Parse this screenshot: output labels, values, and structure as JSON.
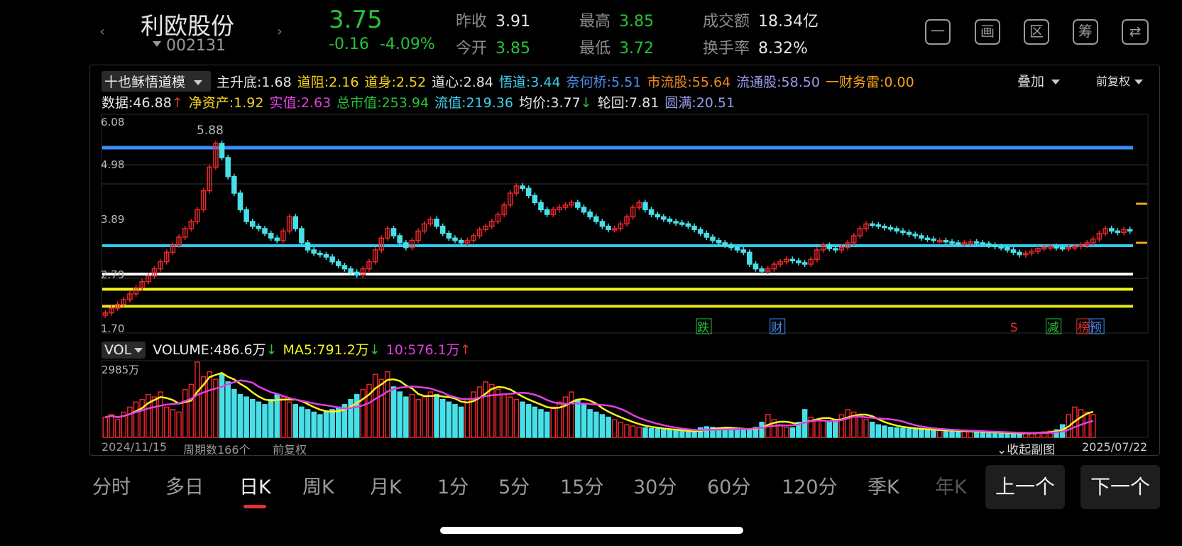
{
  "header": {
    "stock_name": "利欧股份",
    "stock_code": "002131",
    "price": "3.75",
    "change": "-0.16",
    "change_pct": "-4.09%",
    "prev_close_label": "昨收",
    "prev_close": "3.91",
    "open_label": "今开",
    "open": "3.85",
    "high_label": "最高",
    "high": "3.85",
    "low_label": "最低",
    "low": "3.72",
    "turnover_label": "成交额",
    "turnover": "18.34亿",
    "turnover_rate_label": "换手率",
    "turnover_rate": "8.32%",
    "tools": [
      "一",
      "画",
      "区",
      "筹",
      ""
    ]
  },
  "indicator": {
    "name": "十也稣悟道模",
    "items": [
      {
        "label": "主升底",
        "value": "1.68",
        "color": "#e6e6e6"
      },
      {
        "label": "道阻",
        "value": "2.16",
        "color": "#f5d31b"
      },
      {
        "label": "道身",
        "value": "2.52",
        "color": "#f5d31b"
      },
      {
        "label": "道心",
        "value": "2.84",
        "color": "#e6e6e6"
      },
      {
        "label": "悟道",
        "value": "3.44",
        "color": "#3fd0f0"
      },
      {
        "label": "奈何桥",
        "value": "5.51",
        "color": "#4f8ff0"
      },
      {
        "label": "市流股",
        "value": "55.64",
        "color": "#f08a1c"
      },
      {
        "label": "流通股",
        "value": "58.50",
        "color": "#9a9af0"
      },
      {
        "label": "一财务雷",
        "value": "0.00",
        "color": "#f5a21b"
      }
    ],
    "items2": [
      {
        "label": "数据",
        "value": "46.88",
        "color": "#e6e6e6",
        "arrow": "↑",
        "arrow_color": "#e53232"
      },
      {
        "label": "净资产",
        "value": "1.92",
        "color": "#f5d31b"
      },
      {
        "label": "实值",
        "value": "2.63",
        "color": "#e040e0"
      },
      {
        "label": "总市值",
        "value": "253.94",
        "color": "#27c23a"
      },
      {
        "label": "流值",
        "value": "219.36",
        "color": "#3fd0f0"
      },
      {
        "label": "均价",
        "value": "3.77",
        "color": "#e6e6e6",
        "arrow": "↓",
        "arrow_color": "#27c23a"
      },
      {
        "label": "轮回",
        "value": "7.81",
        "color": "#e6e6e6"
      },
      {
        "label": "圆满",
        "value": "20.51",
        "color": "#9a9af0"
      }
    ],
    "overlay_label": "叠加",
    "adjust_label": "前复权"
  },
  "chart_data": {
    "type": "candlestick",
    "y_ticks": [
      "6.08",
      "4.98",
      "3.89",
      "2.79",
      "1.70"
    ],
    "ylim": [
      1.7,
      6.08
    ],
    "max_label": "5.88",
    "h_lines": [
      {
        "value": 5.51,
        "color": "#3a8df5"
      },
      {
        "value": 3.44,
        "color": "#2ec8f0"
      },
      {
        "value": 2.84,
        "color": "#ffffff"
      },
      {
        "value": 2.52,
        "color": "#f5f51b"
      },
      {
        "value": 2.16,
        "color": "#e6e61b"
      }
    ],
    "markers": [
      {
        "text": "跌",
        "color": "#27c23a",
        "index": 98
      },
      {
        "text": "财",
        "color": "#3a8df5",
        "index": 110
      },
      {
        "text": "S",
        "color": "#e53232",
        "index": 149
      },
      {
        "text": "减",
        "color": "#27c23a",
        "index": 155
      },
      {
        "text": "榜",
        "color": "#e53232",
        "index": 160
      },
      {
        "text": "预",
        "color": "#3a8df5",
        "index": 162
      }
    ],
    "closes": [
      2.02,
      2.12,
      2.2,
      2.3,
      2.42,
      2.55,
      2.68,
      2.8,
      2.95,
      3.1,
      3.3,
      3.45,
      3.62,
      3.8,
      3.95,
      4.2,
      4.6,
      5.1,
      5.6,
      5.3,
      4.9,
      4.55,
      4.2,
      3.95,
      3.85,
      3.8,
      3.7,
      3.6,
      3.55,
      3.75,
      4.05,
      3.8,
      3.5,
      3.35,
      3.28,
      3.25,
      3.2,
      3.1,
      3.02,
      2.95,
      2.88,
      2.82,
      2.95,
      3.1,
      3.35,
      3.6,
      3.8,
      3.65,
      3.5,
      3.4,
      3.55,
      3.75,
      3.9,
      4.0,
      3.85,
      3.7,
      3.6,
      3.55,
      3.5,
      3.55,
      3.65,
      3.78,
      3.85,
      3.95,
      4.1,
      4.3,
      4.55,
      4.7,
      4.65,
      4.5,
      4.35,
      4.2,
      4.1,
      4.2,
      4.25,
      4.3,
      4.35,
      4.25,
      4.15,
      4.05,
      3.95,
      3.85,
      3.78,
      3.8,
      3.9,
      4.05,
      4.25,
      4.35,
      4.2,
      4.1,
      4.05,
      4.0,
      3.95,
      3.92,
      3.9,
      3.85,
      3.78,
      3.7,
      3.62,
      3.55,
      3.5,
      3.45,
      3.4,
      3.35,
      3.3,
      3.05,
      2.95,
      2.9,
      2.95,
      3.05,
      3.1,
      3.15,
      3.12,
      3.08,
      3.05,
      3.15,
      3.35,
      3.45,
      3.38,
      3.35,
      3.4,
      3.5,
      3.65,
      3.8,
      3.9,
      3.88,
      3.85,
      3.82,
      3.8,
      3.75,
      3.72,
      3.68,
      3.65,
      3.6,
      3.58,
      3.55,
      3.55,
      3.52,
      3.5,
      3.48,
      3.5,
      3.52,
      3.5,
      3.48,
      3.45,
      3.42,
      3.4,
      3.35,
      3.3,
      3.25,
      3.28,
      3.32,
      3.38,
      3.4,
      3.42,
      3.4,
      3.38,
      3.4,
      3.42,
      3.45,
      3.5,
      3.58,
      3.7,
      3.8,
      3.75,
      3.72,
      3.78,
      3.75
    ],
    "volume_max_label": "2985万",
    "volumes": [
      800,
      900,
      700,
      1000,
      1200,
      1400,
      1500,
      1700,
      1600,
      1800,
      1200,
      1100,
      1000,
      1900,
      2100,
      2985,
      2400,
      2600,
      2300,
      2500,
      2200,
      1900,
      1700,
      1600,
      1500,
      1400,
      1300,
      1500,
      1700,
      1600,
      1400,
      1300,
      1200,
      1100,
      1000,
      900,
      1000,
      1100,
      1200,
      1300,
      1500,
      1700,
      1900,
      2100,
      2500,
      2300,
      2600,
      2000,
      1800,
      1600,
      1700,
      1500,
      1600,
      1800,
      1700,
      1500,
      1400,
      1300,
      1200,
      1500,
      1800,
      2000,
      2200,
      2100,
      1900,
      1700,
      1600,
      1500,
      1400,
      1300,
      1200,
      1100,
      1000,
      1200,
      1400,
      1600,
      1800,
      1500,
      1300,
      1100,
      1000,
      900,
      800,
      700,
      600,
      500,
      450,
      400,
      380,
      350,
      330,
      300,
      280,
      260,
      240,
      220,
      200,
      380,
      420,
      400,
      380,
      360,
      340,
      320,
      300,
      280,
      400,
      600,
      900,
      700,
      500,
      400,
      380,
      600,
      1100,
      800,
      700,
      650,
      600,
      700,
      900,
      1100,
      1000,
      800,
      700,
      600,
      500,
      450,
      400,
      380,
      360,
      340,
      320,
      300,
      290,
      280,
      270,
      260,
      250,
      240,
      230,
      220,
      210,
      200,
      190,
      180,
      170,
      160,
      150,
      160,
      170,
      180,
      200,
      220,
      250,
      300,
      500,
      900,
      1200,
      1100,
      1000,
      900
    ],
    "vol_label": "VOL",
    "volume_text": "VOLUME:486.6万",
    "volume_arrow": "↓",
    "ma5_text": "MA5:791.2万",
    "ma5_arrow": "↓",
    "ma10_text": "10:576.1万",
    "ma10_arrow": "↑",
    "start_date": "2024/11/15",
    "period_count": "周期数166个",
    "period_adjust": "前复权",
    "collapse_label": "收起副图",
    "end_date": "2025/07/22"
  },
  "tabs": [
    "分时",
    "多日",
    "日K",
    "周K",
    "月K",
    "1分",
    "5分",
    "15分",
    "30分",
    "60分",
    "120分",
    "季K",
    "年K"
  ],
  "active_tab": "日K",
  "prev_label": "上一个",
  "next_label": "下一个"
}
